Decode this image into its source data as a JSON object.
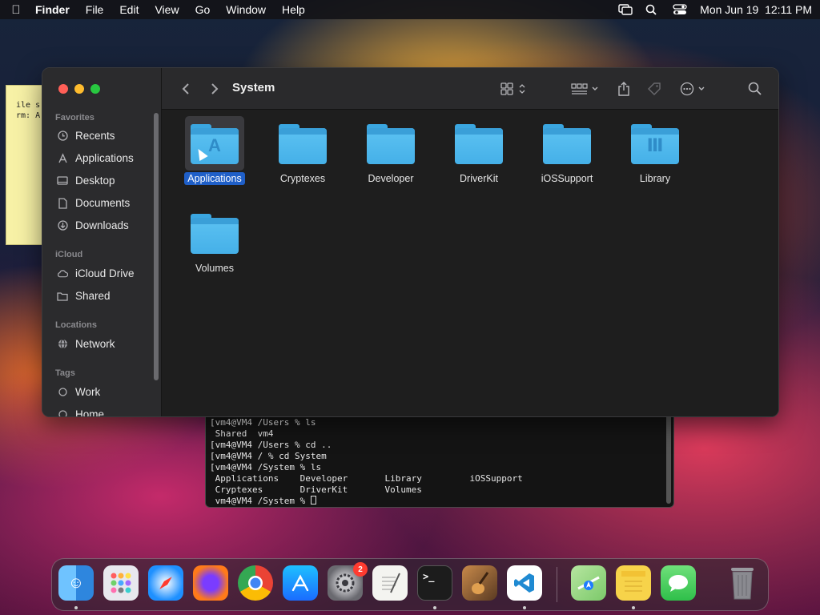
{
  "menubar": {
    "app_name": "Finder",
    "items": [
      "File",
      "Edit",
      "View",
      "Go",
      "Window",
      "Help"
    ],
    "datetime": "Mon Jun 19  12:11 PM"
  },
  "sticky": {
    "lines": [
      "ile s",
      "rm: A"
    ]
  },
  "terminal": {
    "lines": [
      "[vm4@VM4 /Users % ls",
      " Shared  vm4",
      "[vm4@VM4 /Users % cd ..",
      "[vm4@VM4 / % cd System",
      "[vm4@VM4 /System % ls",
      " Applications    Developer       Library         iOSSupport",
      " Cryptexes       DriverKit       Volumes",
      " vm4@VM4 /System % "
    ]
  },
  "finder": {
    "title": "System",
    "sidebar": {
      "favorites_header": "Favorites",
      "favorites": [
        {
          "label": "Recents",
          "icon": "clock-icon"
        },
        {
          "label": "Applications",
          "icon": "apps-icon"
        },
        {
          "label": "Desktop",
          "icon": "desktop-icon"
        },
        {
          "label": "Documents",
          "icon": "document-icon"
        },
        {
          "label": "Downloads",
          "icon": "download-icon"
        }
      ],
      "icloud_header": "iCloud",
      "icloud": [
        {
          "label": "iCloud Drive",
          "icon": "cloud-icon"
        },
        {
          "label": "Shared",
          "icon": "shared-folder-icon"
        }
      ],
      "locations_header": "Locations",
      "locations": [
        {
          "label": "Network",
          "icon": "globe-icon"
        }
      ],
      "tags_header": "Tags",
      "tags": [
        {
          "label": "Work",
          "icon": "tag-circle-icon"
        },
        {
          "label": "Home",
          "icon": "tag-circle-icon"
        }
      ]
    },
    "files": [
      {
        "name": "Applications",
        "glyph": "A",
        "selected": true
      },
      {
        "name": "Cryptexes",
        "glyph": "",
        "selected": false
      },
      {
        "name": "Developer",
        "glyph": "",
        "selected": false
      },
      {
        "name": "DriverKit",
        "glyph": "",
        "selected": false
      },
      {
        "name": "iOSSupport",
        "glyph": "",
        "selected": false
      },
      {
        "name": "Library",
        "glyph": "Ⅲ",
        "selected": false
      },
      {
        "name": "Volumes",
        "glyph": "",
        "selected": false
      }
    ]
  },
  "dock": {
    "apps": [
      {
        "name": "Finder",
        "color": "#2e86de"
      },
      {
        "name": "Launchpad",
        "color": "#e8e8ee"
      },
      {
        "name": "Safari",
        "color": "#1e90ff"
      },
      {
        "name": "Firefox",
        "color": "#ff7a1a"
      },
      {
        "name": "Chrome",
        "color": "#f2f2f2"
      },
      {
        "name": "App Store",
        "color": "#1a8cff"
      },
      {
        "name": "System Settings",
        "color": "#8a8a8e",
        "badge": "2"
      },
      {
        "name": "TextEdit",
        "color": "#f4f4f0"
      },
      {
        "name": "Terminal",
        "color": "#1c1c1c"
      },
      {
        "name": "GarageBand",
        "color": "#5a3a22"
      },
      {
        "name": "Visual Studio Code",
        "color": "#ffffff"
      },
      {
        "name": "Maps",
        "color": "#7cc96a"
      },
      {
        "name": "Notes",
        "color": "#f7d34a"
      },
      {
        "name": "Messages",
        "color": "#34c759"
      },
      {
        "name": "Trash",
        "color": "#8a8a90"
      }
    ]
  }
}
